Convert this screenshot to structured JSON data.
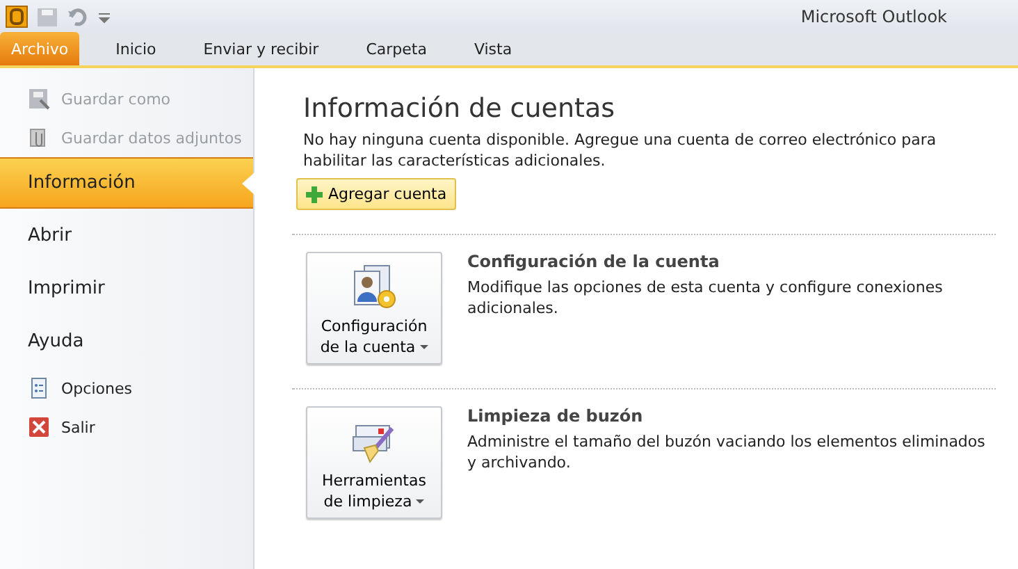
{
  "window": {
    "title": "Microsoft Outlook"
  },
  "tabs": [
    {
      "label": "Archivo",
      "selected": true
    },
    {
      "label": "Inicio",
      "selected": false
    },
    {
      "label": "Enviar y recibir",
      "selected": false
    },
    {
      "label": "Carpeta",
      "selected": false
    },
    {
      "label": "Vista",
      "selected": false
    }
  ],
  "sidebar": {
    "items": [
      {
        "kind": "command",
        "label": "Guardar como",
        "disabled": true
      },
      {
        "kind": "command",
        "label": "Guardar datos adjuntos",
        "disabled": true
      },
      {
        "kind": "page",
        "label": "Información",
        "selected": true
      },
      {
        "kind": "page",
        "label": "Abrir",
        "selected": false
      },
      {
        "kind": "page",
        "label": "Imprimir",
        "selected": false
      },
      {
        "kind": "page",
        "label": "Ayuda",
        "selected": false
      },
      {
        "kind": "command",
        "label": "Opciones",
        "disabled": false
      },
      {
        "kind": "command",
        "label": "Salir",
        "disabled": false
      }
    ]
  },
  "content": {
    "title": "Información de cuentas",
    "message": "No hay ninguna cuenta disponible. Agregue una cuenta de correo electrónico para habilitar las características adicionales.",
    "add_button": "Agregar cuenta",
    "sections": [
      {
        "button": [
          "Configuración",
          "de la cuenta"
        ],
        "title": "Configuración de la cuenta",
        "description": "Modifique las opciones de esta cuenta y configure conexiones adicionales."
      },
      {
        "button": [
          "Herramientas",
          "de limpieza"
        ],
        "title": "Limpieza de buzón",
        "description": "Administre el tamaño del buzón vaciando los elementos eliminados y archivando."
      }
    ]
  }
}
